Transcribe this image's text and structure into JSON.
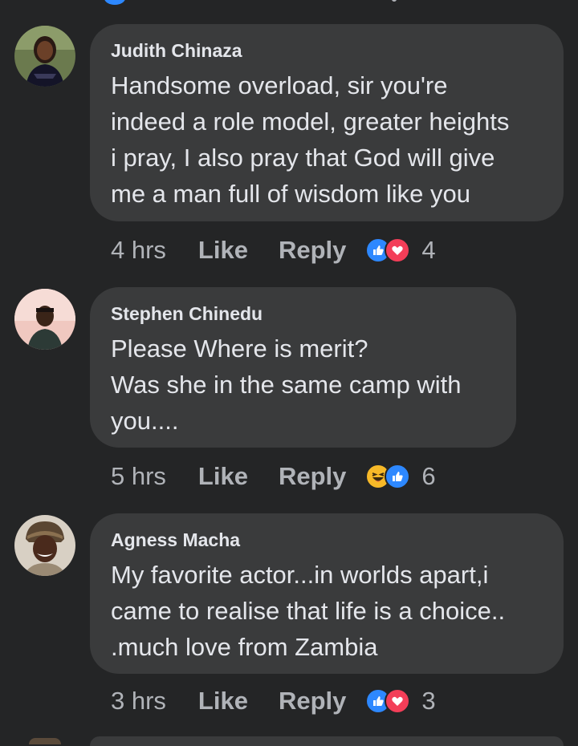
{
  "comments": [
    {
      "author": "Judith Chinaza",
      "text": "Handsome overload, sir you're\nindeed a role model, greater heights\ni pray, I also pray that God will give\nme a man full of wisdom like you",
      "time": "4 hrs",
      "like_label": "Like",
      "reply_label": "Reply",
      "reactions": [
        "like-icon",
        "love-icon"
      ],
      "reaction_count": "4"
    },
    {
      "author": "Stephen Chinedu",
      "text": "Please Where is merit?\nWas she in the same camp with\nyou....",
      "time": "5 hrs",
      "like_label": "Like",
      "reply_label": "Reply",
      "reactions": [
        "haha-icon",
        "like-icon"
      ],
      "reaction_count": "6"
    },
    {
      "author": "Agness Macha",
      "text": "My favorite actor...in  worlds apart,i\ncame to realise that life is a choice..\n.much love from Zambia",
      "time": "3 hrs",
      "like_label": "Like",
      "reply_label": "Reply",
      "reactions": [
        "like-icon",
        "love-icon"
      ],
      "reaction_count": "3"
    }
  ],
  "colors": {
    "background": "#242526",
    "bubble": "#3a3b3c",
    "primary_text": "#e4e6eb",
    "secondary_text": "#b0b3b8",
    "like_blue": "#2d88ff",
    "love_red": "#f33e58",
    "haha_yellow": "#f7b928"
  }
}
